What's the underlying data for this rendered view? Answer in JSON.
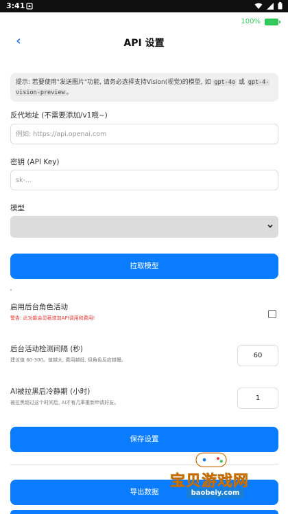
{
  "status_bar": {
    "time": "3:41"
  },
  "battery": {
    "percent": "100%",
    "level": 1.0
  },
  "header": {
    "back_label": "‹",
    "title": "API 设置"
  },
  "tip": {
    "prefix": "提示: 若要使用\"发送图片\"功能, 请务必选择支持Vision(视觉)的模型, 如 ",
    "model1": "gpt-4o",
    "mid": " 或 ",
    "model2": "gpt-4-vision-preview",
    "suffix": "。"
  },
  "proxy": {
    "label": "反代地址 (不需要添加/v1哦~)",
    "placeholder": "例如: https://api.openai.com"
  },
  "apikey": {
    "label": "密钥 (API Key)",
    "placeholder": "sk-..."
  },
  "model": {
    "label": "模型",
    "selected": ""
  },
  "fetch_button": "拉取模型",
  "background_activity": {
    "label": "启用后台角色活动",
    "warning": "警告: 此功能会显著增加API调用和费用!",
    "checked": false
  },
  "interval": {
    "title": "后台活动检测间隔 (秒)",
    "subtitle": "建议值 60-300。值越大, 费用越低, 但角色反应越慢。",
    "value": "60"
  },
  "cooldown": {
    "title": "AI被拉黑后冷静期 (小时)",
    "subtitle": "被拉黑超过这个时间后, AI才有几率重新申请好友。",
    "value": "1"
  },
  "save_button": "保存设置",
  "export_button": "导出数据",
  "watermark": {
    "text": "宝贝游戏网",
    "url": "baobeiy.com"
  },
  "colors": {
    "accent": "#0a7cff",
    "warning": "#e53935",
    "battery": "#34c759"
  }
}
